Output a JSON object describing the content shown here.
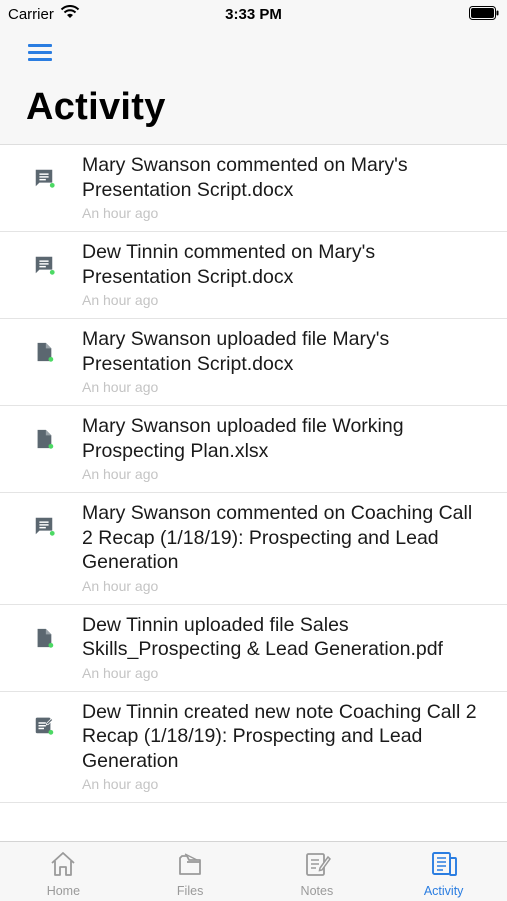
{
  "status_bar": {
    "carrier": "Carrier",
    "time": "3:33 PM"
  },
  "header": {
    "title": "Activity"
  },
  "activities": [
    {
      "icon": "comment-icon",
      "text": "Mary Swanson commented on Mary's Presentation Script.docx",
      "time": "An hour ago"
    },
    {
      "icon": "comment-icon",
      "text": "Dew Tinnin commented on Mary's Presentation Script.docx",
      "time": "An hour ago"
    },
    {
      "icon": "file-icon",
      "text": "Mary Swanson uploaded file Mary's Presentation Script.docx",
      "time": "An hour ago"
    },
    {
      "icon": "file-icon",
      "text": "Mary Swanson uploaded file Working Prospecting Plan.xlsx",
      "time": "An hour ago"
    },
    {
      "icon": "comment-icon",
      "text": "Mary Swanson commented on Coaching Call 2 Recap (1/18/19): Prospecting and Lead Generation",
      "time": "An hour ago"
    },
    {
      "icon": "file-icon",
      "text": "Dew Tinnin uploaded file Sales Skills_Prospecting & Lead Generation.pdf",
      "time": "An hour ago"
    },
    {
      "icon": "note-icon",
      "text": "Dew Tinnin created new note Coaching Call 2 Recap (1/18/19): Prospecting and Lead Generation",
      "time": "An hour ago"
    }
  ],
  "tabs": [
    {
      "label": "Home",
      "icon": "home-icon",
      "active": false
    },
    {
      "label": "Files",
      "icon": "folder-icon",
      "active": false
    },
    {
      "label": "Notes",
      "icon": "notes-icon",
      "active": false
    },
    {
      "label": "Activity",
      "icon": "activity-icon",
      "active": true
    }
  ],
  "colors": {
    "accent": "#2a7de1",
    "unread_dot": "#4cd964",
    "icon_gray": "#5b6770",
    "time_gray": "#c4c4c4"
  }
}
